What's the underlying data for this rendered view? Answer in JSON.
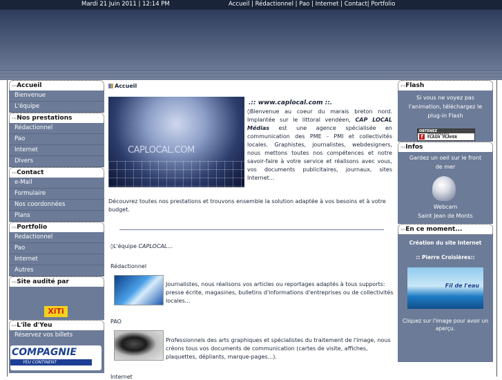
{
  "topbar": {
    "datetime": "Mardi 21 Juin 2011 | 12:14 PM",
    "nav": [
      "Accueil",
      "Rédactionnel",
      "Pao",
      "Internet",
      "Contact",
      "Portfolio"
    ]
  },
  "left": {
    "accueil": {
      "title": "Accueil",
      "items": [
        "Bienvenue",
        "L'équipe"
      ]
    },
    "prestations": {
      "title": "Nos prestations",
      "items": [
        "Rédactionnel",
        "Pao",
        "Internet",
        "Divers"
      ]
    },
    "contact": {
      "title": "Contact",
      "items": [
        "e-Mail",
        "Formulaire",
        "Nos coordonnées",
        "Plans"
      ]
    },
    "portfolio": {
      "title": "Portfolio",
      "items": [
        "Redactionnel",
        "Pao",
        "Internet",
        "Autres"
      ]
    },
    "audit": {
      "title": "Site audité par",
      "badge": "XiTi"
    },
    "yeu": {
      "title": "L'île d'Yeu",
      "link": "Réservez vos billets",
      "banner": "COMPAGNIE",
      "banner_sub": "YEU CONTINENT"
    }
  },
  "main": {
    "breadcrumb": "Accueil",
    "image_text": "CAPLOCAL.COM",
    "site_title": ".:: www.caplocal.com ::.",
    "intro_prefix": "Bienvenue au coeur du marais breton nord. Implantée sur le littoral vendéen, ",
    "intro_brand": "CAP LOCAL Médias",
    "intro_rest": " est une agence spécialisée en communication des PME - PMI et collectivités locales. Graphistes, journalistes, webdesigners, nous mettons toutes nos compétences et notre savoir-faire à votre service et réalisons avec vous, vos documents publicitaires, journaux, sites Internet...",
    "paragraph2": "Découvrez toutes nos prestations et trouvons ensemble la solution adaptée à vos besoins et à votre budget.",
    "team_prefix": "L'équipe ",
    "team_brand": "CAPLOCAL",
    "team_suffix": "...",
    "redac_title": "Rédactionnel",
    "redac_text": "Journalistes, nous réalisons vos articles ou reportages adaptés à tous supports: presse écrite, magasines, bulletins d'informations d'entreprises ou de collectivités locales...",
    "pao_title": "PAO",
    "pao_text": "Professionnels des arts graphiques et spécialistes du traitement de l'image, nous créons tous vos documents de communication (cartes de visite, affiches, plaquettes, dépliants, marque-pages...).",
    "internet_title": "Internet"
  },
  "right": {
    "flash": {
      "title": "Flash",
      "text": "Si vous ne voyez pas l'animation, téléchargez le plug-in Flash",
      "badge_top": "OBTENEZ",
      "badge_line1": "macromedia",
      "badge_line2": "FLASH",
      "badge_line3": "PLAYER"
    },
    "infos": {
      "title": "Infos",
      "text": "Gardez un oeil sur le front de mer",
      "caption1": "Webcam",
      "caption2": "Saint Jean de Monts"
    },
    "moment": {
      "title": "En ce moment...",
      "headline": "Création du site Internet",
      "subhead": ":: Pierre Croisières::",
      "ad_text": "Fil de l'eau",
      "caption": "Cliquez sur l'image pour avoir un aperçu."
    }
  }
}
